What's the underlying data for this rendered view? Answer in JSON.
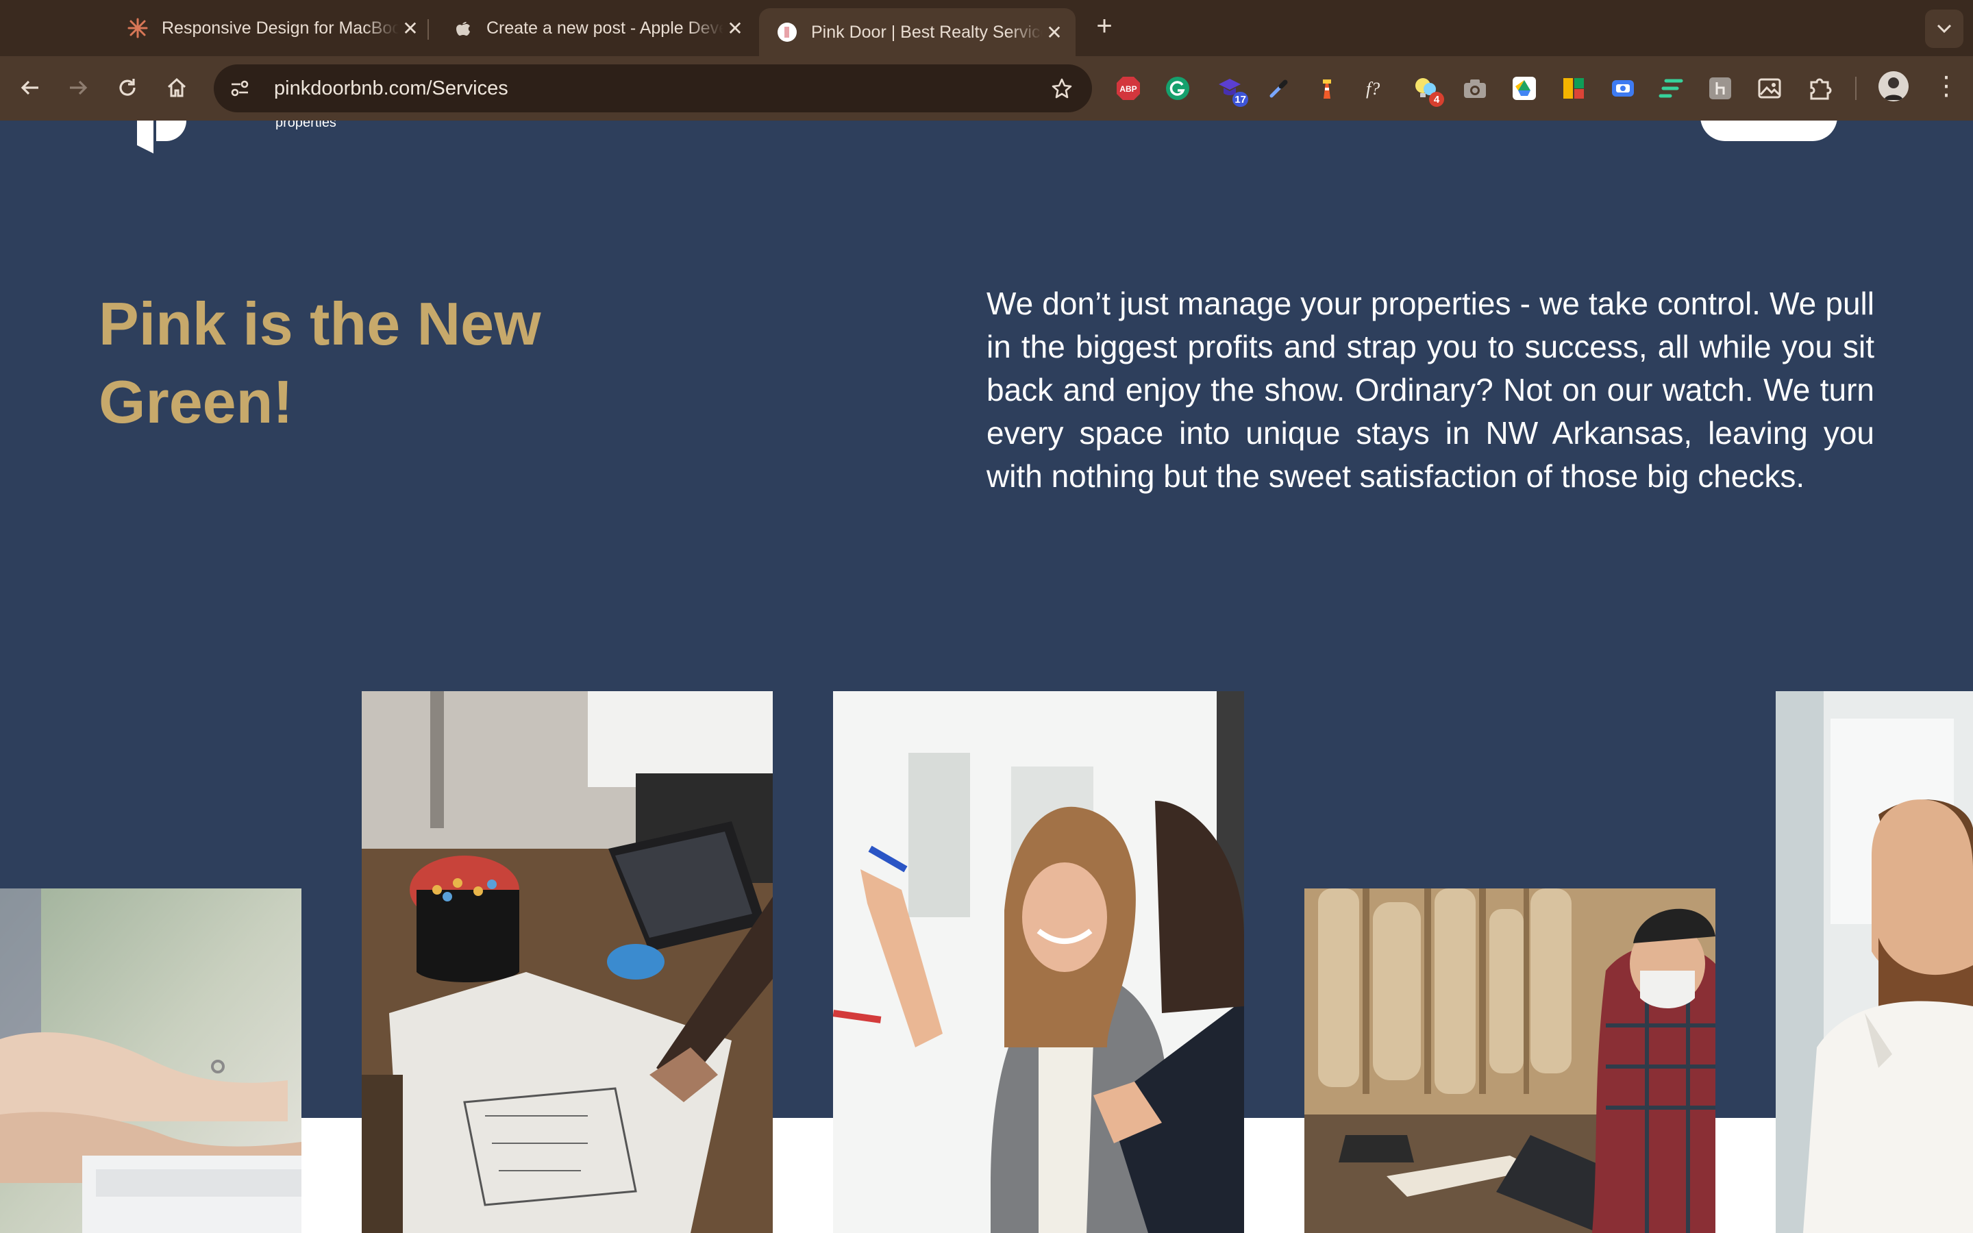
{
  "browser": {
    "tabs": [
      {
        "title": "Responsive Design for MacBook",
        "icon": "claude-sparkle-icon",
        "active": false
      },
      {
        "title": "Create a new post - Apple Developer",
        "icon": "apple-icon",
        "active": false
      },
      {
        "title": "Pink Door | Best Realty Services",
        "icon": "pinkdoor-favicon",
        "active": true
      }
    ],
    "address": {
      "host": "pinkdoorbnb.com",
      "path": "/Services"
    },
    "extensions": [
      {
        "name": "adblock-plus",
        "label": "ABP"
      },
      {
        "name": "grammarly",
        "label": "G"
      },
      {
        "name": "extension-17",
        "badge": "17"
      },
      {
        "name": "eyedropper"
      },
      {
        "name": "lighthouse"
      },
      {
        "name": "font-identifier",
        "label": "f?"
      },
      {
        "name": "ideas-extension",
        "badge": "4"
      },
      {
        "name": "screenshot-camera"
      },
      {
        "name": "google-drive"
      },
      {
        "name": "colorful-extension"
      },
      {
        "name": "screen-recorder"
      },
      {
        "name": "stripes-extension"
      },
      {
        "name": "gray-extension"
      },
      {
        "name": "image-extension"
      },
      {
        "name": "extensions-puzzle"
      }
    ],
    "colors": {
      "chrome": "#4d3a2c",
      "tabstrip": "#3a2a1f",
      "omnibox": "#2d2018"
    }
  },
  "page": {
    "header": {
      "logo_subtext": "properties"
    },
    "hero": {
      "headline": "Pink is the New Green!",
      "intro": "We don’t just manage your properties - we take control. We pull in the biggest profits and strap you to success, all while you sit back and enjoy the show. Ordinary? Not on our watch. We turn every space into unique stays in NW Arkansas, leaving you with nothing but the sweet satisfaction of those big checks."
    },
    "gallery": [
      {
        "name": "typing-hands-photo"
      },
      {
        "name": "architect-desk-photo"
      },
      {
        "name": "smiling-woman-whiteboard-photo"
      },
      {
        "name": "woodworker-laptop-photo"
      },
      {
        "name": "bearded-man-photo"
      }
    ],
    "colors": {
      "background": "#2e3f5c",
      "headline": "#c7a96b",
      "text": "#ffffff"
    }
  }
}
